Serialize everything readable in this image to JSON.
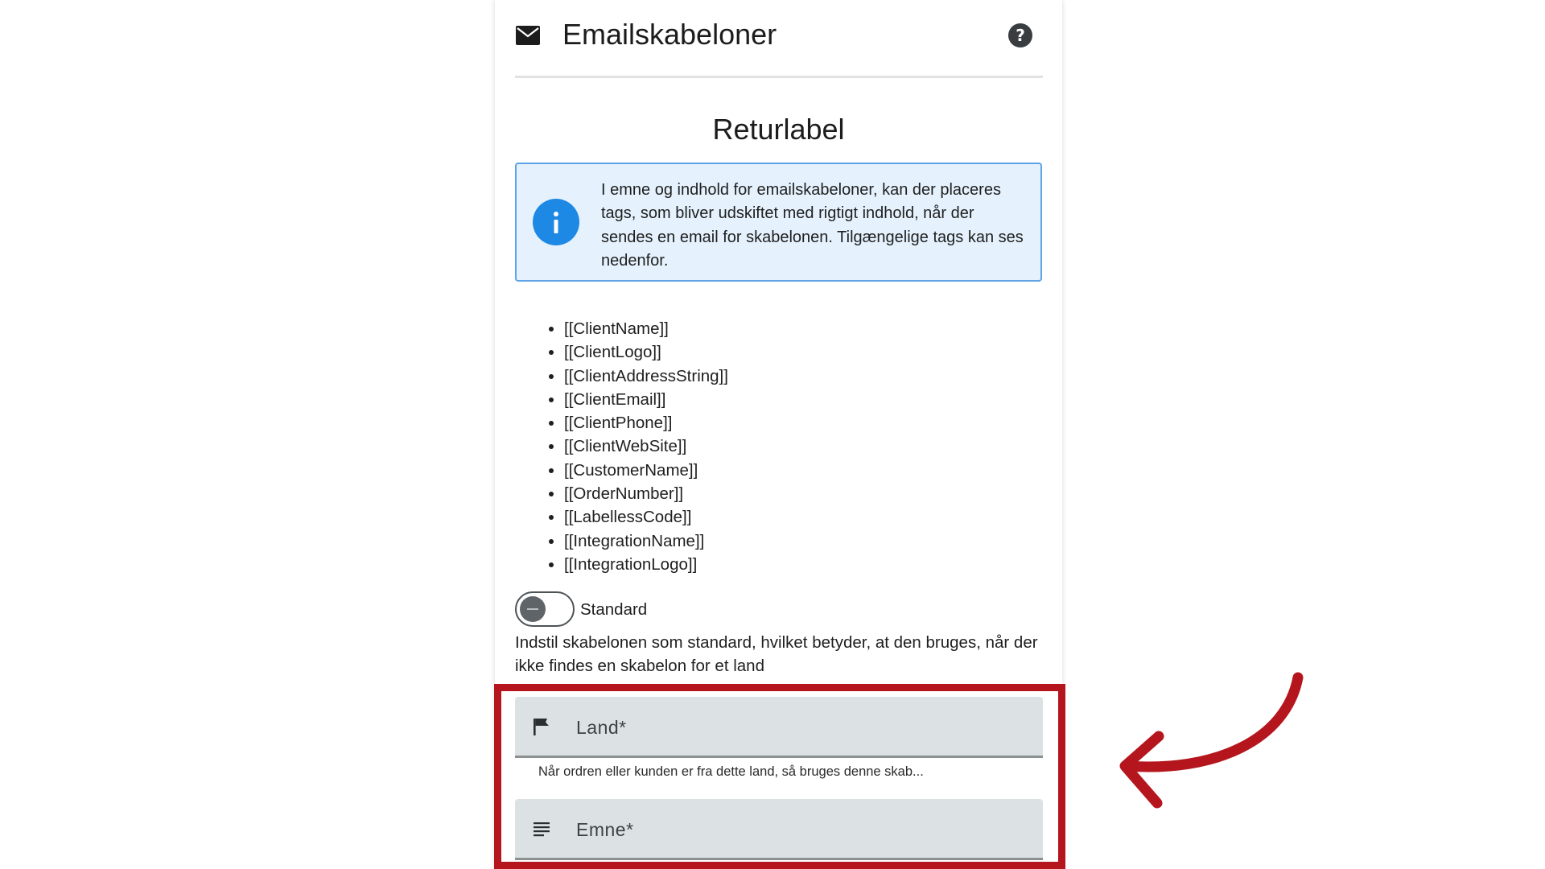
{
  "header": {
    "title": "Emailskabeloner",
    "mail_icon": "mail-icon",
    "help_icon": "help-icon"
  },
  "section_title": "Returlabel",
  "info_box": {
    "icon": "info-icon",
    "text": "I emne og indhold for emailskabeloner, kan der placeres tags, som bliver udskiftet med rigtigt indhold, når der sendes en email for skabelonen. Tilgængelige tags kan ses nedenfor."
  },
  "tags": [
    "[[ClientName]]",
    "[[ClientLogo]]",
    "[[ClientAddressString]]",
    "[[ClientEmail]]",
    "[[ClientPhone]]",
    "[[ClientWebSite]]",
    "[[CustomerName]]",
    "[[OrderNumber]]",
    "[[LabellessCode]]",
    "[[IntegrationName]]",
    "[[IntegrationLogo]]"
  ],
  "standard_toggle": {
    "label": "Standard",
    "checked": false,
    "description": "Indstil skabelonen som standard, hvilket betyder, at den bruges, når der ikke findes en skabelon for et land"
  },
  "country_field": {
    "label": "Land*",
    "icon": "flag-icon",
    "hint": "Når ordren eller kunden er fra dette land, så bruges denne skab..."
  },
  "subject_field": {
    "label": "Emne*",
    "icon": "text-lines-icon"
  },
  "colors": {
    "highlight": "#b5161d",
    "info_bg": "#e5f2fd",
    "info_border": "#5da3e6",
    "info_icon": "#1e88e5",
    "field_bg": "#dce2e3"
  }
}
